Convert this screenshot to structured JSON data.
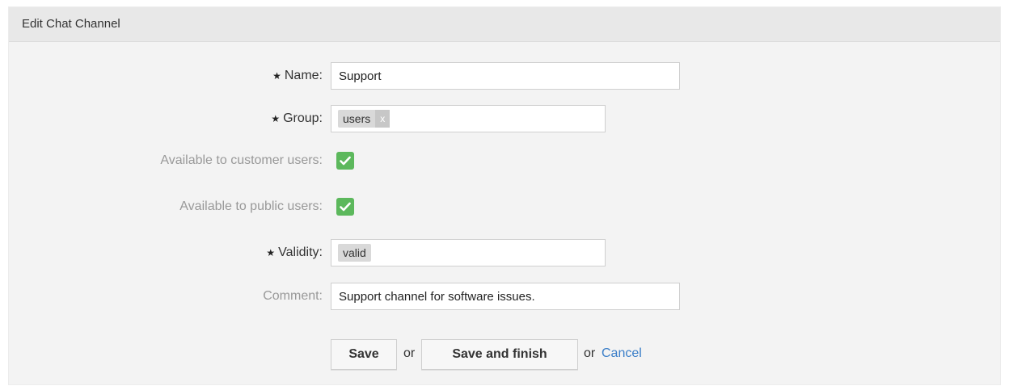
{
  "panel": {
    "title": "Edit Chat Channel"
  },
  "form": {
    "name": {
      "label": "Name:",
      "required_mark": "★",
      "value": "Support"
    },
    "group": {
      "label": "Group:",
      "required_mark": "★",
      "tags": [
        "users"
      ],
      "tag_remove": "x"
    },
    "customer_users": {
      "label": "Available to customer users:",
      "checked": true
    },
    "public_users": {
      "label": "Available to public users:",
      "checked": true
    },
    "validity": {
      "label": "Validity:",
      "required_mark": "★",
      "value": "valid"
    },
    "comment": {
      "label": "Comment:",
      "value": "Support channel for software issues."
    }
  },
  "actions": {
    "save_label": "Save",
    "or_1": "or",
    "save_finish_label": "Save and finish",
    "or_2": "or",
    "cancel_label": "Cancel"
  },
  "colors": {
    "checkbox": "#5cb85c",
    "link": "#3a7ec8"
  }
}
